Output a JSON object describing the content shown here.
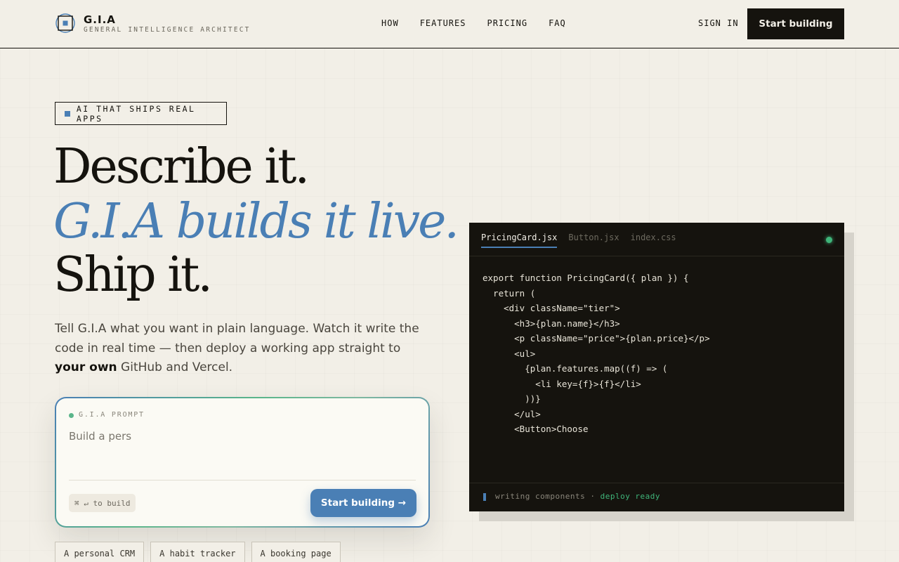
{
  "brand": {
    "name": "G.I.A",
    "tagline": "GENERAL INTELLIGENCE ARCHITECT"
  },
  "nav": {
    "items": [
      "HOW",
      "FEATURES",
      "PRICING",
      "FAQ"
    ],
    "sign_in": "SIGN IN",
    "cta": "Start building"
  },
  "hero": {
    "badge": "AI THAT SHIPS REAL APPS",
    "headline_1": "Describe it.",
    "headline_2": "G.I.A builds it live.",
    "headline_3": "Ship it.",
    "lede_pre": "Tell G.I.A what you want in plain language. Watch it write the code in real time — then deploy a working app straight to ",
    "lede_strong": "your own",
    "lede_post": " GitHub and Vercel."
  },
  "prompt": {
    "label": "G.I.A PROMPT",
    "value": "Build a pers",
    "hint": "⌘ ↵ to build",
    "button": "Start building →"
  },
  "suggestions": [
    "A personal CRM",
    "A habit tracker",
    "A booking page"
  ],
  "editor": {
    "tabs": [
      "PricingCard.jsx",
      "Button.jsx",
      "index.css"
    ],
    "code_lines": [
      "export function PricingCard({ plan }) {",
      "  return (",
      "    <div className=\"tier\">",
      "      <h3>{plan.name}</h3>",
      "      <p className=\"price\">{plan.price}</p>",
      "      <ul>",
      "        {plan.features.map((f) => (",
      "          <li key={f}>{f}</li>",
      "        ))}",
      "      </ul>",
      "      <Button>Choose"
    ],
    "status": "writing components ·",
    "status_ok": "deploy ready"
  },
  "colors": {
    "background": "#f2efe7",
    "ink": "#15130e",
    "accent_blue": "#4a7fb5",
    "accent_green": "#3fb57a"
  }
}
